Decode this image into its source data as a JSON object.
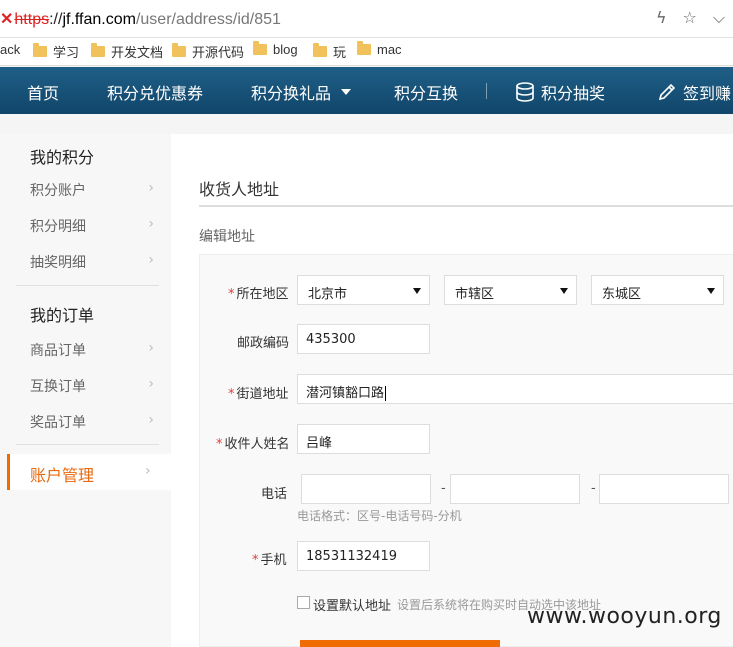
{
  "browser": {
    "url_scheme": "https",
    "url_sep": "://",
    "url_host": "jf.ffan.com",
    "url_path": "/user/address/id/851"
  },
  "bookmarks": [
    "ack",
    "学习",
    "开发文档",
    "开源代码",
    "blog",
    "玩",
    "mac"
  ],
  "nav": {
    "items": [
      "首页",
      "积分兑优惠券",
      "积分换礼品",
      "积分互换",
      "积分抽奖",
      "签到赚"
    ]
  },
  "sidebar": {
    "section1": "我的积分",
    "section1_items": [
      "积分账户",
      "积分明细",
      "抽奖明细"
    ],
    "section2": "我的订单",
    "section2_items": [
      "商品订单",
      "互换订单",
      "奖品订单"
    ],
    "active_item": "账户管理"
  },
  "main": {
    "title": "收货人地址",
    "subtitle": "编辑地址"
  },
  "form": {
    "region_label": "所在地区",
    "province": "北京市",
    "city": "市辖区",
    "district": "东城区",
    "postal_label": "邮政编码",
    "postal_value": "435300",
    "street_label": "街道地址",
    "street_value": "潜河镇豁口路",
    "receiver_label": "收件人姓名",
    "receiver_value": "吕峰",
    "phone_label": "电话",
    "phone_sep": "-",
    "phone_hint": "电话格式：区号-电话号码-分机",
    "mobile_label": "手机",
    "mobile_value": "18531132419",
    "default_label": "设置默认地址",
    "default_hint": "设置后系统将在购买时自动选中该地址",
    "required_mark": "*"
  },
  "watermark": "www.wooyun.org"
}
